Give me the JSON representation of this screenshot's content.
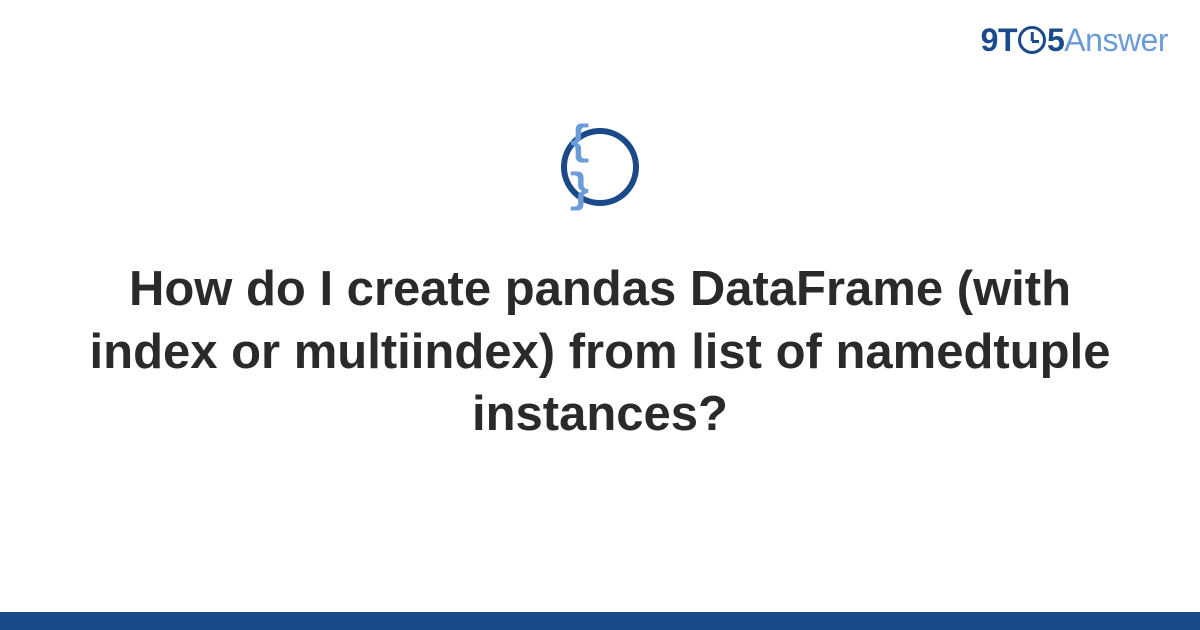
{
  "brand": {
    "part1": "9T",
    "part2": "5",
    "part3": "Answer"
  },
  "icon": {
    "name": "code-braces-icon",
    "glyph": "{ }"
  },
  "title": "How do I create pandas DataFrame (with index or multiindex) from list of namedtuple instances?",
  "colors": {
    "primary": "#1a4a8a",
    "secondary": "#6b9bd8",
    "text": "#2a2a2a"
  }
}
